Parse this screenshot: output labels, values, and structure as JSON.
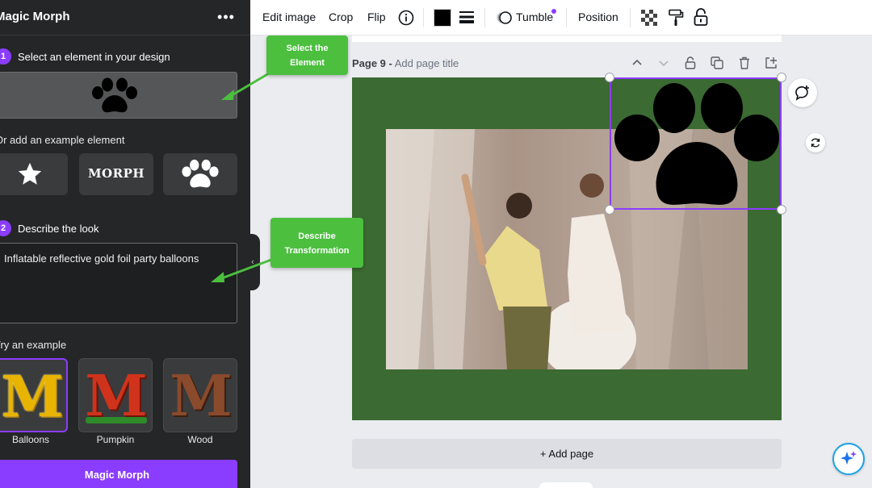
{
  "panel": {
    "title": "Magic Morph",
    "more_icon": "ellipsis-icon",
    "step1": {
      "num": "1",
      "label": "Select an element in your design"
    },
    "example_label": "Or add an example element",
    "examples": [
      {
        "icon": "star-icon"
      },
      {
        "label": "MORPH"
      },
      {
        "icon": "paw-icon"
      }
    ],
    "step2": {
      "num": "2",
      "label": "Describe the look"
    },
    "description": "Inflatable reflective gold foil party balloons",
    "try_label": "Try an example",
    "styles": [
      {
        "label": "Balloons",
        "selected": true,
        "color": "#e8b400"
      },
      {
        "label": "Pumpkin",
        "selected": false,
        "color": "#d0331c"
      },
      {
        "label": "Wood",
        "selected": false,
        "color": "#8a4a2c"
      }
    ],
    "submit_label": "Magic Morph"
  },
  "toolbar": {
    "edit_image": "Edit image",
    "crop": "Crop",
    "flip": "Flip",
    "color_swatch": "#000000",
    "tumble": "Tumble",
    "position": "Position"
  },
  "canvas": {
    "page_number": "Page 9 -",
    "page_title_placeholder": "Add page title",
    "page_bg": "#3b6a32",
    "add_page": "+ Add page"
  },
  "callouts": {
    "select_line1": "Select the",
    "select_line2": "Element",
    "describe_line1": "Describe",
    "describe_line2": "Transformation",
    "color": "#4cbf3f"
  },
  "accent": "#8b3dff"
}
